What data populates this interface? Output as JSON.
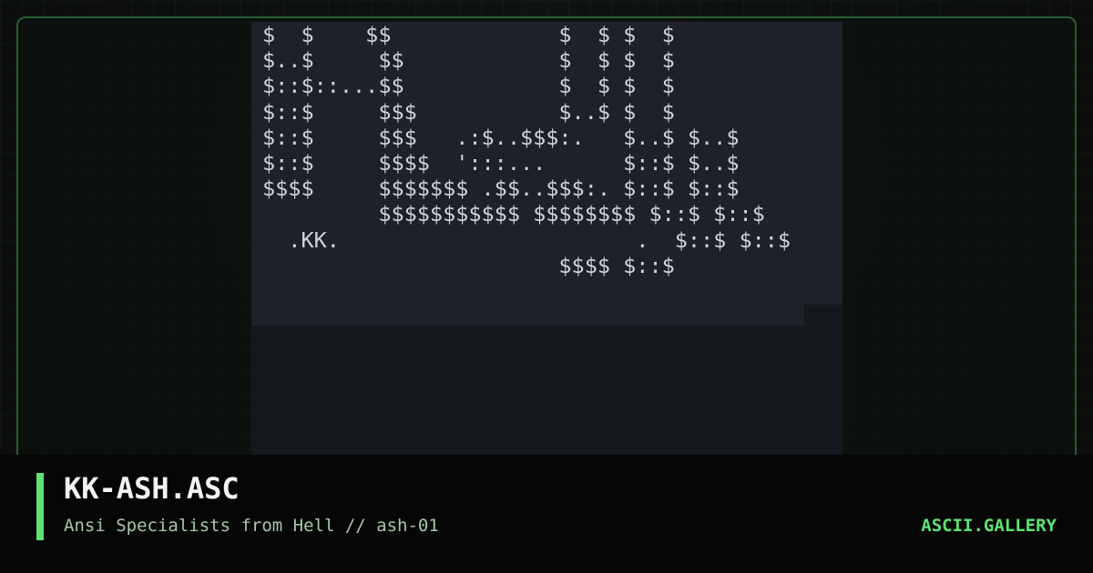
{
  "artwork": {
    "lines": [
      "$  $    $$             $  $ $  $",
      "$..$     $$            $  $ $  $",
      "$::$::...$$            $  $ $  $",
      "$::$     $$$           $..$ $  $",
      "$::$     $$$   .:$..$$$:.   $..$ $..$",
      "$::$     $$$$  ':::...      $::$ $..$",
      "$$$$     $$$$$$$ .$$..$$$:. $::$ $::$",
      "         $$$$$$$$$$$ $$$$$$$$ $::$ $::$",
      "  .KK.                       .  $::$ $::$",
      "                       $$$$ $::$"
    ]
  },
  "caption": {
    "title": "KK-ASH.ASC",
    "subtitle": "Ansi Specialists from Hell // ash-01",
    "site": "ASCII.GALLERY"
  },
  "colors": {
    "accent": "#5ee372",
    "frame_border": "#2d5b34",
    "art_background": "#1e2128",
    "art_text": "#cfd3da"
  }
}
